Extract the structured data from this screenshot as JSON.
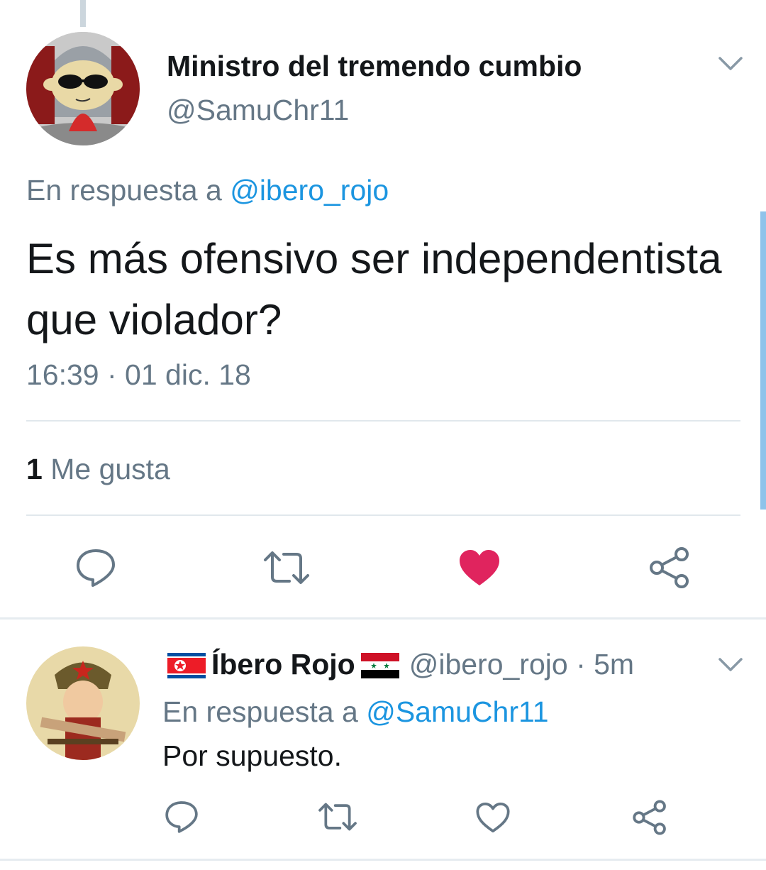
{
  "main_tweet": {
    "display_name": "Ministro del tremendo cumbio",
    "handle": "@SamuChr11",
    "reply_prefix": "En respuesta a",
    "reply_mention": "@ibero_rojo",
    "text": "Es más ofensivo ser independentista que violador?",
    "timestamp": "16:39 · 01 dic. 18",
    "likes_count": "1",
    "likes_label": "Me gusta",
    "liked": true,
    "icons": [
      "reply-icon",
      "retweet-icon",
      "like-icon",
      "share-icon"
    ]
  },
  "reply_tweet": {
    "flag_left": "north-korea-flag",
    "display_name": "Íbero Rojo",
    "flag_right": "syria-flag",
    "handle_time": "@ibero_rojo · 5m",
    "reply_prefix": "En respuesta a",
    "reply_mention": "@SamuChr11",
    "text": "Por supuesto.",
    "liked": false,
    "icons": [
      "reply-icon",
      "retweet-icon",
      "like-icon",
      "share-icon"
    ]
  },
  "colors": {
    "text": "#14171a",
    "secondary": "#657786",
    "link": "#1b95e0",
    "like_red": "#e0245e",
    "divider": "#e1e8ed"
  }
}
